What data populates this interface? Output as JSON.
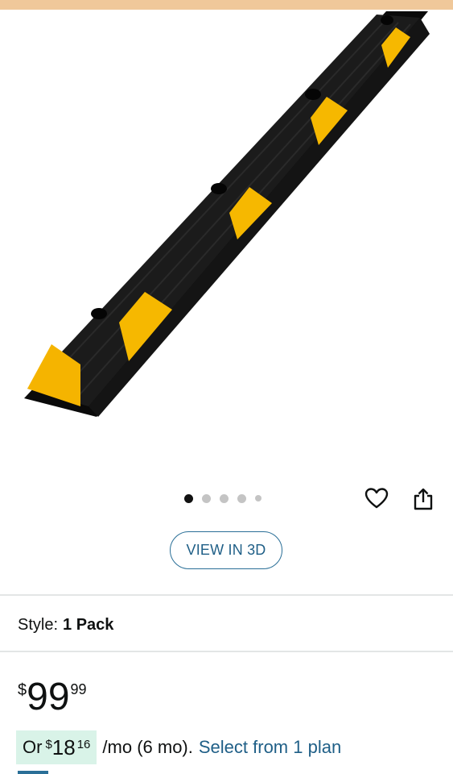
{
  "product": {
    "image_alt": "Black rubber parking curb with yellow reflective stripes",
    "image_count": 5,
    "active_image": 1
  },
  "actions": {
    "favorite_icon": "heart-icon",
    "share_icon": "share-icon",
    "view_3d_label": "VIEW IN 3D"
  },
  "style": {
    "label": "Style:",
    "value": "1 Pack"
  },
  "price": {
    "currency": "$",
    "whole": "99",
    "fraction": "99"
  },
  "financing": {
    "prefix": "Or",
    "currency": "$",
    "whole": "18",
    "fraction": "16",
    "term": "/mo (6 mo).",
    "link_text": "Select from 1 plan"
  },
  "colors": {
    "link": "#1f5f87",
    "accent_border": "#2a6f97",
    "financing_highlight": "#d9f3e8",
    "stripe_yellow": "#f6b800",
    "rubber_black": "#111111"
  }
}
